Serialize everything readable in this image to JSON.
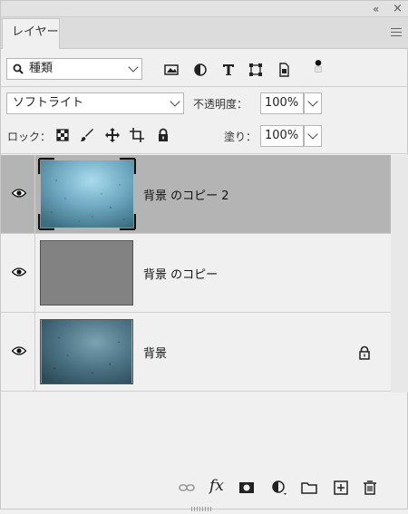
{
  "window": {
    "collapse_label": "«",
    "close_label": "×"
  },
  "tabs": [
    {
      "label": "レイヤー"
    }
  ],
  "filter": {
    "kind_label": "種類",
    "filter_icons": [
      "image-filter-icon",
      "adjustment-filter-icon",
      "text-filter-icon",
      "shape-filter-icon",
      "smart-object-filter-icon",
      "filter-toggle-icon"
    ]
  },
  "blend": {
    "mode": "ソフトライト",
    "opacity_label": "不透明度：",
    "opacity_value": "100%"
  },
  "lock": {
    "label": "ロック：",
    "icons": [
      "lock-transparent-icon",
      "lock-image-icon",
      "lock-position-icon",
      "lock-artboard-icon",
      "lock-all-icon"
    ],
    "fill_label": "塗り：",
    "fill_value": "100%"
  },
  "layers": [
    {
      "name": "背景 のコピー 2",
      "selected": true,
      "visible": true,
      "locked": false
    },
    {
      "name": "背景 のコピー",
      "selected": false,
      "visible": true,
      "locked": false
    },
    {
      "name": "背景",
      "selected": false,
      "visible": true,
      "locked": true
    }
  ],
  "footer": {
    "icons": [
      "link-layers-icon",
      "fx-icon",
      "add-mask-icon",
      "new-adjustment-icon",
      "new-group-icon",
      "new-layer-icon",
      "delete-layer-icon"
    ],
    "fx_label": "fx"
  }
}
